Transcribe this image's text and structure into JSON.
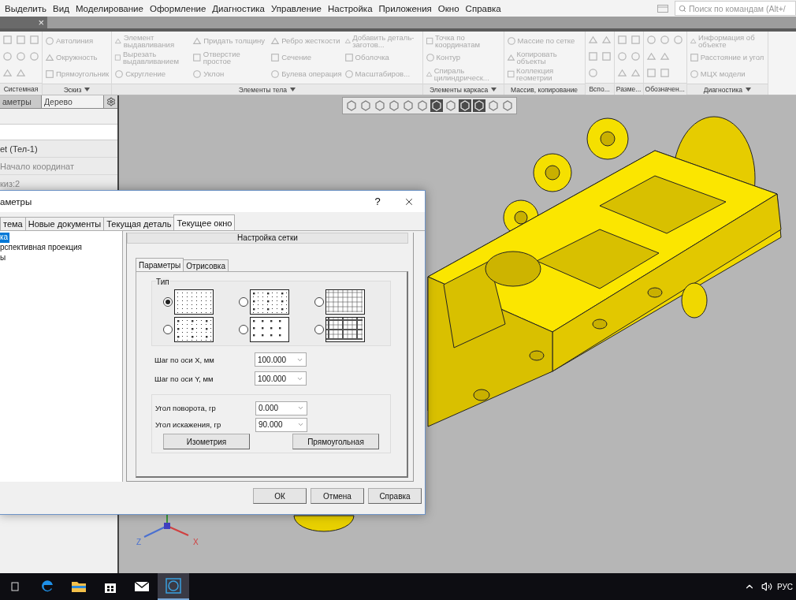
{
  "menu": {
    "items": [
      "Выделить",
      "Вид",
      "Моделирование",
      "Оформление",
      "Диагностика",
      "Управление",
      "Настройка",
      "Приложения",
      "Окно",
      "Справка"
    ],
    "search": {
      "placeholder": "Поиск по командам (Alt+/"
    }
  },
  "doc_tab": {
    "close": "×"
  },
  "ribbon": {
    "disabled": true,
    "groups": [
      {
        "label": "Системная",
        "kind": "icons",
        "menu": false
      },
      {
        "label": "Эскиз",
        "kind": "buttons",
        "menu": true,
        "items": [
          "Автолиния",
          "Окружность",
          "Прямоугольник"
        ]
      },
      {
        "label": "Элементы тела",
        "kind": "buttons",
        "menu": true,
        "items": [
          "Элемент выдавливания",
          "Вырезать выдавливанием",
          "Скругление",
          "Придать толщину",
          "Отверстие простое",
          "Уклон",
          "Ребро жесткости",
          "Сечение",
          "Булева операция",
          "Добавить деталь-заготов...",
          "Оболочка",
          "Масштабиров..."
        ]
      },
      {
        "label": "Элементы каркаса",
        "kind": "buttons",
        "menu": true,
        "items": [
          "Точка по координатам",
          "Контур",
          "Спираль цилиндрическ..."
        ]
      },
      {
        "label": "Массив, копирование",
        "kind": "buttons",
        "menu": false,
        "items": [
          "Массие по сетке",
          "Копировать объекты",
          "Коллекция геометрии"
        ]
      },
      {
        "label": "Вспо...",
        "kind": "icons",
        "menu": false
      },
      {
        "label": "Разме...",
        "kind": "icons",
        "menu": false
      },
      {
        "label": "Обозначен...",
        "kind": "icons",
        "menu": false
      },
      {
        "label": "Диагностика",
        "kind": "buttons",
        "menu": true,
        "items": [
          "Информация об объекте",
          "Расстояние и угол",
          "МЦХ модели"
        ]
      }
    ]
  },
  "side_panel": {
    "tabs": [
      {
        "label": "аметры",
        "selected": false
      },
      {
        "label": "Дерево",
        "selected": true
      }
    ],
    "tree": [
      {
        "label": "et (Тел-1)",
        "dimmed": false
      },
      {
        "label": "Начало координат",
        "dimmed": true
      },
      {
        "label": "киз:2",
        "dimmed": true
      }
    ]
  },
  "viewport": {
    "axes": [
      "Z",
      "X"
    ]
  },
  "dialog": {
    "title": "аметры",
    "help": "?",
    "tabs": [
      {
        "label": "тема",
        "selected": false
      },
      {
        "label": "Новые документы",
        "selected": false
      },
      {
        "label": "Текущая деталь",
        "selected": false
      },
      {
        "label": "Текущее окно",
        "selected": true
      }
    ],
    "tree": [
      {
        "label": "ка",
        "selected": true
      },
      {
        "label": "рспективная проекция",
        "selected": false
      },
      {
        "label": "ы",
        "selected": false
      }
    ],
    "section_title": "Настройка сетки",
    "subtabs": [
      {
        "label": "Параметры",
        "selected": true
      },
      {
        "label": "Отрисовка",
        "selected": false
      }
    ],
    "type_label": "Тип",
    "grid_types": [
      {
        "kind": "dots",
        "selected": true
      },
      {
        "kind": "mixed",
        "selected": false
      },
      {
        "kind": "lines",
        "selected": false
      },
      {
        "kind": "accent",
        "selected": false
      },
      {
        "kind": "sparse",
        "selected": false
      },
      {
        "kind": "bold-lines",
        "selected": false
      }
    ],
    "steps": [
      {
        "label": "Шаг по оси  X, мм",
        "value": "100.000"
      },
      {
        "label": "Шаг по оси  Y, мм",
        "value": "100.000"
      }
    ],
    "angles": [
      {
        "label": "Угол поворота, гр",
        "value": "0.000"
      },
      {
        "label": "Угол искажения, гр",
        "value": "90.000"
      }
    ],
    "presets": [
      "Изометрия",
      "Прямоугольная"
    ],
    "buttons": [
      "ОК",
      "Отмена",
      "Справка"
    ]
  },
  "taskbar": {
    "language": "РУС"
  }
}
